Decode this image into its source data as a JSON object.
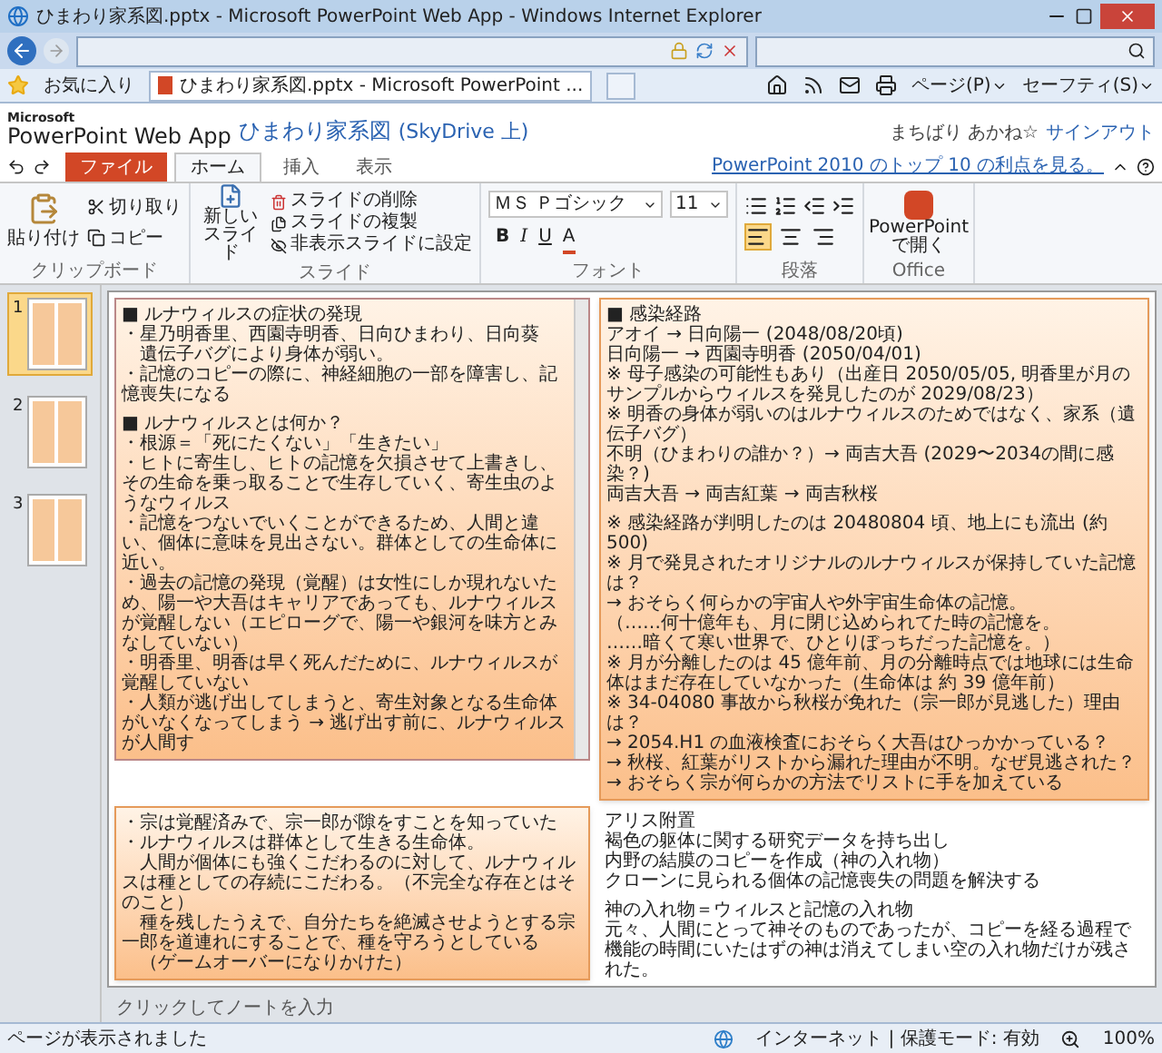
{
  "browser": {
    "title": "ひまわり家系図.pptx - Microsoft PowerPoint Web App - Windows Internet Explorer",
    "favorites": "お気に入り",
    "tab": "ひまわり家系図.pptx - Microsoft PowerPoint ...",
    "commands": [
      "ページ(P)",
      "セーフティ(S)"
    ]
  },
  "app": {
    "vendor": "Microsoft",
    "product": "PowerPoint Web App",
    "document": "ひまわり家系図",
    "location": "(SkyDrive 上)",
    "user": "まちばり あかね☆",
    "signout": "サインアウト"
  },
  "ribbon": {
    "tabs": [
      {
        "label": "ファイル",
        "kind": "file",
        "selected": false
      },
      {
        "label": "ホーム",
        "kind": "tab",
        "selected": true
      },
      {
        "label": "挿入",
        "kind": "tab",
        "selected": false
      },
      {
        "label": "表示",
        "kind": "tab",
        "selected": false
      }
    ],
    "promo": "PowerPoint 2010 のトップ 10 の利点を見る。",
    "clipboard": {
      "label": "クリップボード",
      "paste": "貼り付け",
      "cut": "切り取り",
      "copy": "コピー"
    },
    "slides": {
      "label": "スライド",
      "new": "新しいスライド",
      "delete": "スライドの削除",
      "duplicate": "スライドの複製",
      "hide": "非表示スライドに設定"
    },
    "font": {
      "label": "フォント",
      "name": "ＭＳ Ｐゴシック",
      "size": "11",
      "formats": [
        "B",
        "I",
        "U",
        "A"
      ]
    },
    "paragraph": {
      "label": "段落",
      "align": [
        {
          "kind": "left",
          "selected": true
        },
        {
          "kind": "center",
          "selected": false
        },
        {
          "kind": "right",
          "selected": false
        }
      ]
    },
    "office": {
      "label": "Office",
      "open": "PowerPoint で開く"
    }
  },
  "thumbnails": [
    {
      "number": "1",
      "selected": true
    },
    {
      "number": "2",
      "selected": false
    },
    {
      "number": "3",
      "selected": false
    }
  ],
  "slide": {
    "left_box": {
      "scrollable": true,
      "sections": [
        [
          "■ ルナウィルスの症状の発現",
          "・星乃明香里、西園寺明香、日向ひまわり、日向葵",
          "　遺伝子バグにより身体が弱い。",
          "・記憶のコピーの際に、神経細胞の一部を障害し、記憶喪失になる"
        ],
        [
          "■ ルナウィルスとは何か？",
          "・根源＝「死にたくない」「生きたい」",
          "・ヒトに寄生し、ヒトの記憶を欠損させて上書きし、その生命を乗っ取ることで生存していく、寄生虫のようなウィルス",
          "・記憶をつないでいくことができるため、人間と違い、個体に意味を見出さない。群体としての生命体に近い。",
          "・過去の記憶の発現（覚醒）は女性にしか現れないため、陽一や大吾はキャリアであっても、ルナウィルスが覚醒しない（エピローグで、陽一や銀河を味方とみなしていない）",
          "・明香里、明香は早く死んだために、ルナウィルスが覚醒していない",
          "・人類が逃げ出してしまうと、寄生対象となる生命体がいなくなってしまう → 逃げ出す前に、ルナウィルスが人間す"
        ]
      ]
    },
    "right_box": {
      "sections": [
        [
          "■ 感染経路",
          "アオイ → 日向陽一 (2048/08/20頃)",
          "日向陽一 → 西園寺明香 (2050/04/01)",
          "※ 母子感染の可能性もあり（出産日 2050/05/05, 明香里が月のサンプルからウィルスを発見したのが 2029/08/23）",
          "※ 明香の身体が弱いのはルナウィルスのためではなく、家系（遺伝子バグ）",
          "不明（ひまわりの誰か？）→ 両吉大吾 (2029〜2034の間に感染？)",
          "両吉大吾 → 両吉紅葉 → 両吉秋桜"
        ],
        [
          "※ 感染経路が判明したのは 20480804 頃、地上にも流出 (約 500)",
          "※ 月で発見されたオリジナルのルナウィルスが保持していた記憶は？",
          "→ おそらく何らかの宇宙人や外宇宙生命体の記憶。",
          "（……何十億年も、月に閉じ込められてた時の記憶を。",
          "……暗くて寒い世界で、ひとりぼっちだった記憶を。）",
          "※ 月が分離したのは 45 億年前、月の分離時点では地球には生命体はまだ存在していなかった（生命体は 約 39 億年前）",
          "※ 34-04080 事故から秋桜が免れた（宗一郎が見逃した）理由は？",
          "→ 2054.H1 の血液検査におそらく大吾はひっかかっている？",
          "→ 秋桜、紅葉がリストから漏れた理由が不明。なぜ見逃された？",
          "→ おそらく宗が何らかの方法でリストに手を加えている"
        ]
      ]
    },
    "bottom_box": {
      "sections": [
        [
          "・宗は覚醒済みで、宗一郎が隙をすことを知っていた",
          "・ルナウィルスは群体として生きる生命体。",
          "　人間が個体にも強くこだわるのに対して、ルナウィルスは種としての存続にこだわる。（不完全な存在とはそのこと）",
          "　種を残したうえで、自分たちを絶滅させようとする宗一郎を道連れにすることで、種を守ろうとしている",
          "　（ゲームオーバーになりかけた）"
        ]
      ]
    },
    "note": {
      "sections": [
        [
          "アリス附置",
          "褐色の躯体に関する研究データを持ち出し",
          "内野の結膜のコピーを作成（神の入れ物）",
          "クローンに見られる個体の記憶喪失の問題を解決する"
        ],
        [
          "神の入れ物＝ウィルスと記憶の入れ物",
          "元々、人間にとって神そのものであったが、コピーを経る過程で機能の時間にいたはずの神は消えてしまい空の入れ物だけが残された。"
        ]
      ]
    }
  },
  "notes": {
    "placeholder": "クリックしてノートを入力"
  },
  "status_bar": {
    "message": "ページが表示されました",
    "zone": "インターネット | 保護モード: 有効",
    "zoom": "100%"
  }
}
